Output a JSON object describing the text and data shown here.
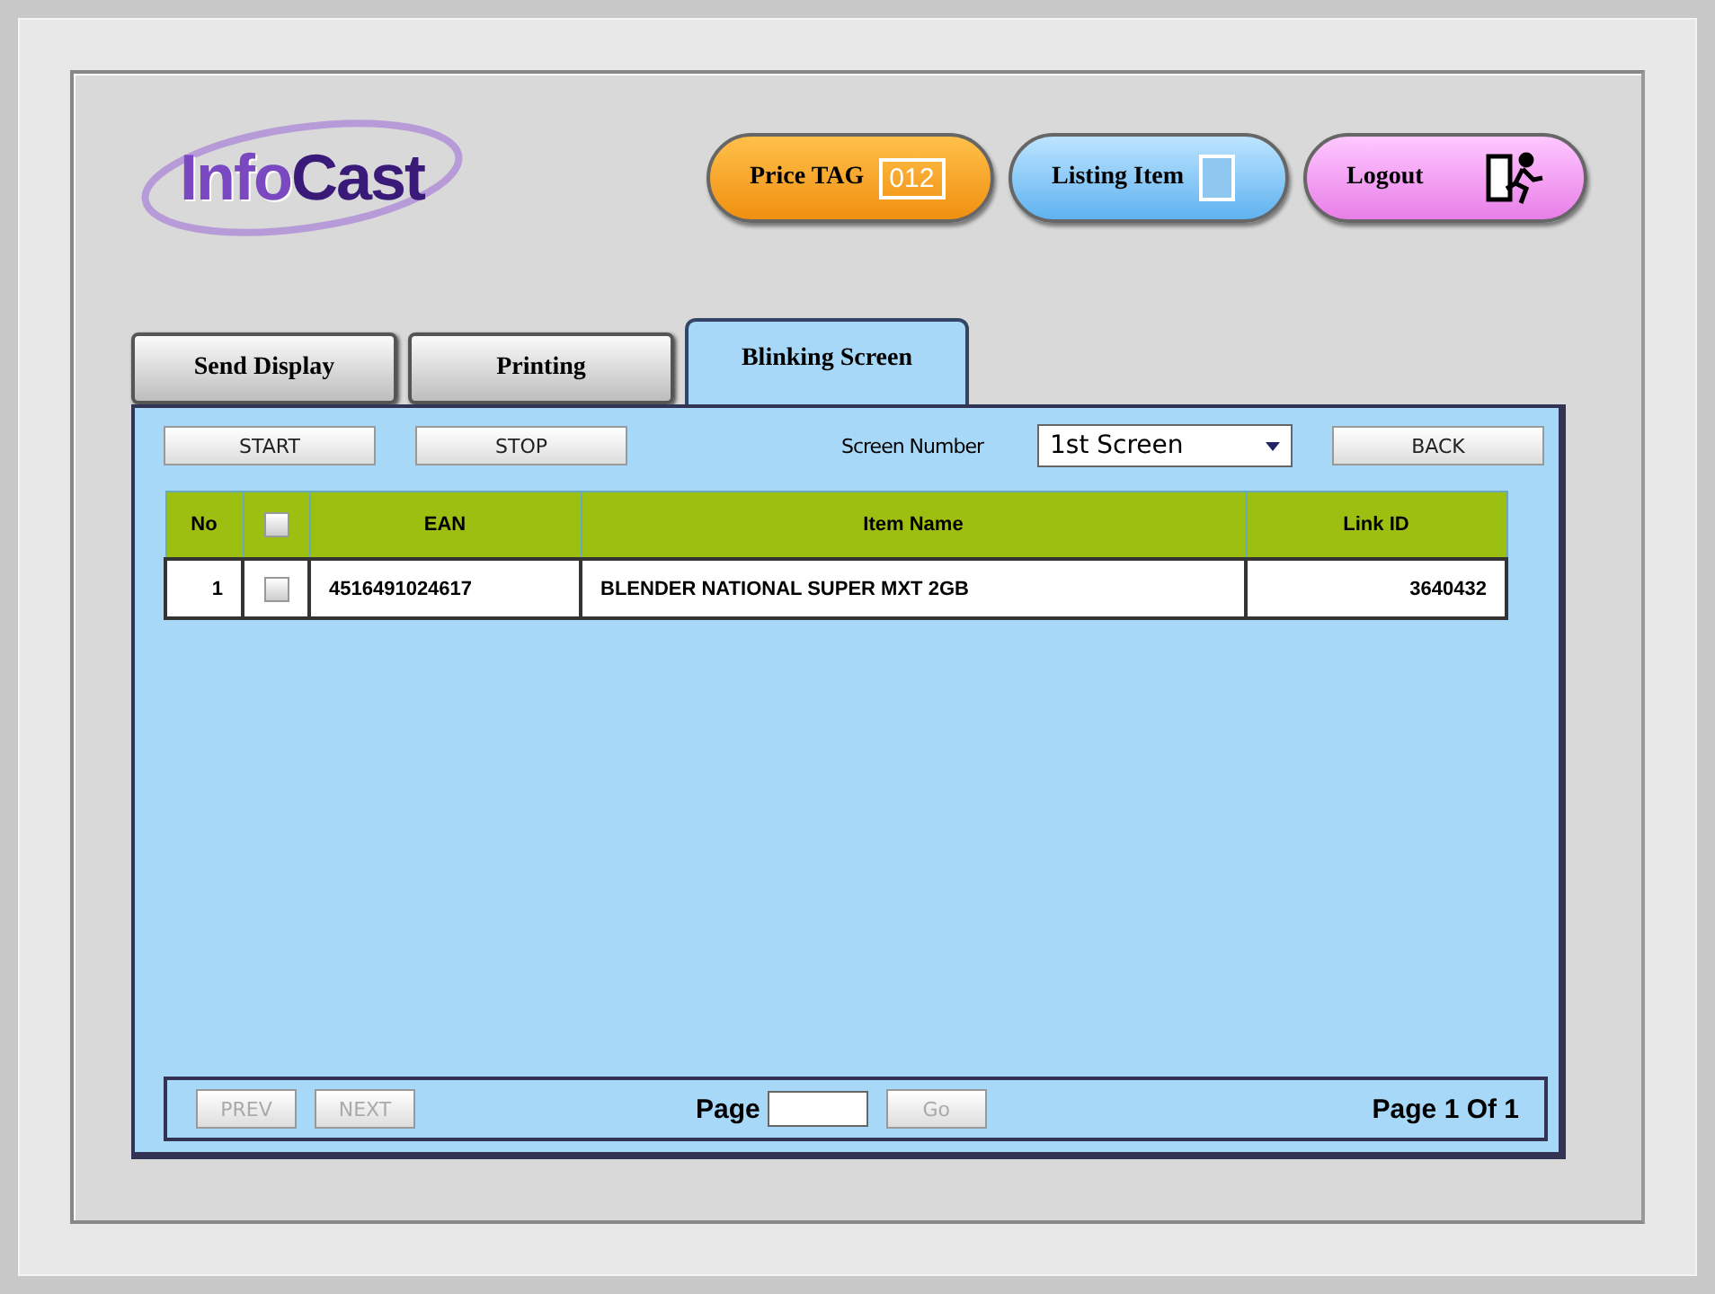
{
  "logo": {
    "first": "Info",
    "second": "Cast"
  },
  "header_buttons": [
    {
      "kind": "price",
      "label": "Price TAG",
      "badge": "012"
    },
    {
      "kind": "listing",
      "label": "Listing Item"
    },
    {
      "kind": "logout",
      "label": "Logout"
    }
  ],
  "tabs": [
    {
      "label": "Send Display",
      "selected": false
    },
    {
      "label": "Printing",
      "selected": false
    },
    {
      "label": "Blinking Screen",
      "selected": true
    }
  ],
  "toolbar": {
    "start": "START",
    "stop": "STOP",
    "screen_label": "Screen Number",
    "screen_value": "1st Screen",
    "back": "BACK"
  },
  "table": {
    "columns": [
      "No",
      "EAN",
      "Item Name",
      "Link ID"
    ],
    "header_checked": false,
    "rows": [
      {
        "no": "1",
        "checked": false,
        "ean": "4516491024617",
        "item_name": "BLENDER NATIONAL SUPER MXT 2GB",
        "link_id": "3640432"
      }
    ]
  },
  "pager": {
    "prev": {
      "label": "PREV",
      "disabled": true
    },
    "next": {
      "label": "NEXT",
      "disabled": true
    },
    "page_label": "Page",
    "go": {
      "label": "Go",
      "disabled": true
    },
    "status": "Page 1 Of 1"
  }
}
